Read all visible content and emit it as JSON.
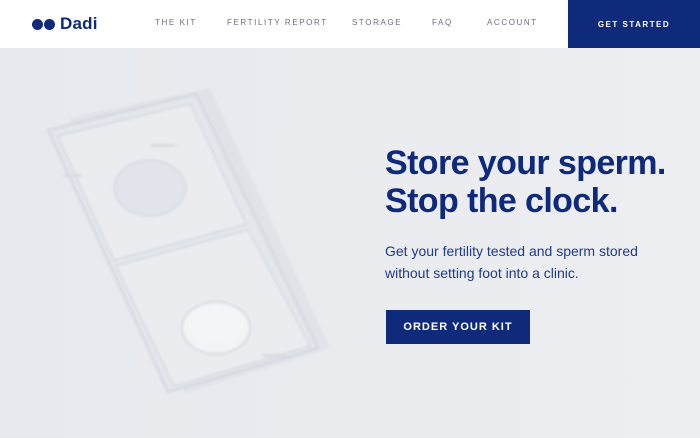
{
  "brand": {
    "name": "Dadi",
    "color": "#0f2a7a"
  },
  "nav": {
    "links": [
      {
        "label": "THE KIT"
      },
      {
        "label": "FERTILITY REPORT"
      },
      {
        "label": "STORAGE"
      },
      {
        "label": "FAQ"
      },
      {
        "label": "ACCOUNT"
      }
    ],
    "cta_label": "GET STARTED"
  },
  "hero": {
    "headline_line1": "Store your sperm.",
    "headline_line2": "Stop the clock.",
    "subtext": "Get your fertility tested and sperm stored without setting foot into a clinic.",
    "button_label": "ORDER YOUR KIT",
    "image_icon": "sperm-kit-box-image"
  },
  "colors": {
    "accent": "#0f2a7a",
    "background": "#eceef1",
    "nav_text": "#6b6f79"
  }
}
